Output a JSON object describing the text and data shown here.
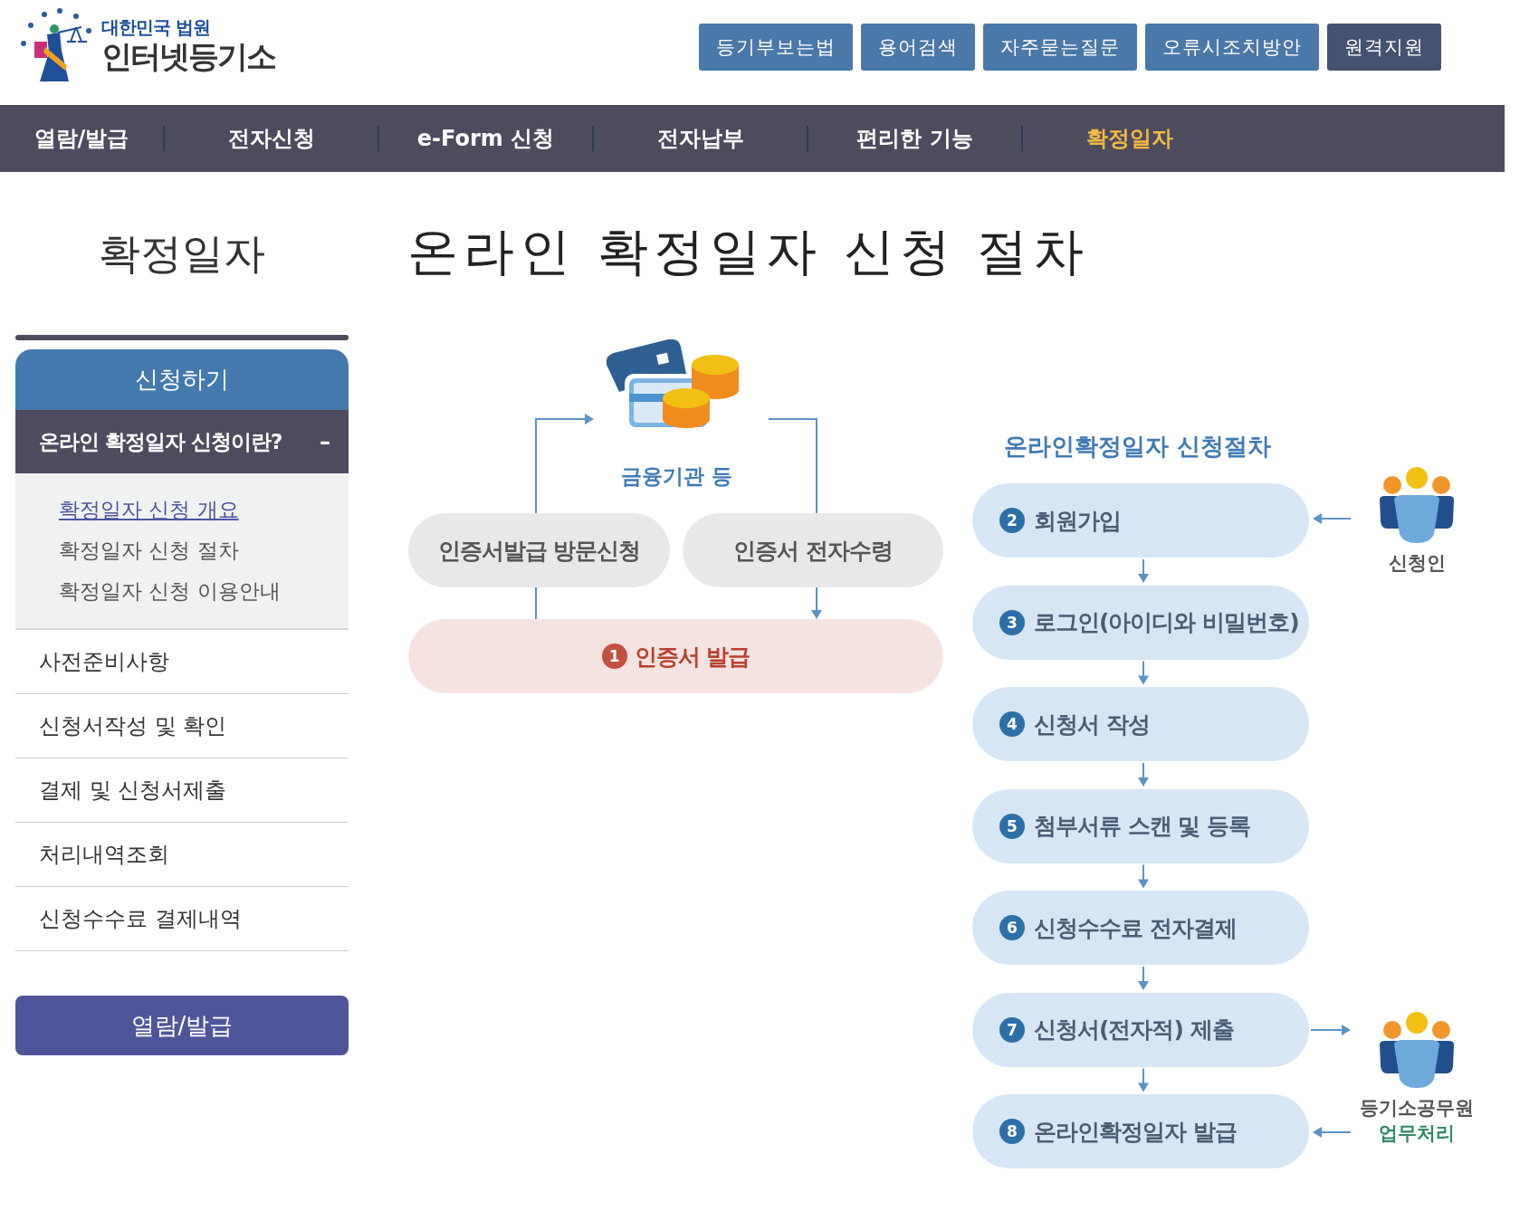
{
  "logo": {
    "org": "대한민국 법원",
    "name": "인터넷등기소"
  },
  "top_links": [
    {
      "label": "등기부보는법",
      "kind": "normal"
    },
    {
      "label": "용어검색",
      "kind": "normal"
    },
    {
      "label": "자주묻는질문",
      "kind": "normal"
    },
    {
      "label": "오류시조치방안",
      "kind": "normal"
    },
    {
      "label": "원격지원",
      "kind": "dark"
    }
  ],
  "nav": [
    {
      "label": "열람/발급",
      "selected": false
    },
    {
      "label": "전자신청",
      "selected": false
    },
    {
      "label": "e-Form 신청",
      "selected": false
    },
    {
      "label": "전자납부",
      "selected": false
    },
    {
      "label": "편리한 기능",
      "selected": false
    },
    {
      "label": "확정일자",
      "selected": true
    }
  ],
  "sidebar": {
    "title": "확정일자",
    "section": "신청하기",
    "items": [
      {
        "label": "온라인 확정일자 신청이란?",
        "expanded": true,
        "toggle": "–",
        "children": [
          {
            "label": "확정일자 신청 개요",
            "selected": true
          },
          {
            "label": "확정일자 신청 절차",
            "selected": false
          },
          {
            "label": "확정일자 신청 이용안내",
            "selected": false
          }
        ]
      },
      {
        "label": "사전준비사항",
        "expanded": false
      },
      {
        "label": "신청서작성 및 확인",
        "expanded": false
      },
      {
        "label": "결제 및 신청서제출",
        "expanded": false
      },
      {
        "label": "처리내역조회",
        "expanded": false
      },
      {
        "label": "신청수수료 결제내역",
        "expanded": false
      }
    ],
    "button": "열람/발급"
  },
  "page_title": "온라인 확정일자 신청 절차",
  "diagram": {
    "institution": "금융기관 등",
    "visit": "인증서발급 방문신청",
    "receive": "인증서 전자수령",
    "issue": {
      "number": "1",
      "label": "인증서 발급"
    },
    "flow_title": "온라인확정일자 신청절차",
    "steps": [
      {
        "number": "2",
        "label": "회원가입"
      },
      {
        "number": "3",
        "label": "로그인(아이디와 비밀번호)"
      },
      {
        "number": "4",
        "label": "신청서 작성"
      },
      {
        "number": "5",
        "label": "첨부서류 스캔 및 등록"
      },
      {
        "number": "6",
        "label": "신청수수료 전자결제"
      },
      {
        "number": "7",
        "label": "신청서(전자적) 제출"
      },
      {
        "number": "8",
        "label": "온라인확정일자 발급"
      }
    ],
    "applicant": "신청인",
    "officer": "등기소공무원",
    "officer_role": "업무처리"
  }
}
